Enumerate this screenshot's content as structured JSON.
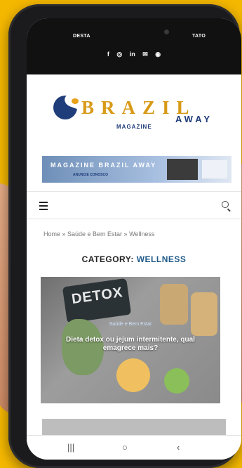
{
  "top_menu": {
    "left": "DESTA",
    "right": "TATO"
  },
  "social_icons": [
    "f",
    "◎",
    "in",
    "✉",
    "◉"
  ],
  "logo": {
    "brand": "BRAZIL",
    "sub": "MAGAZINE",
    "away": "AWAY"
  },
  "banner": {
    "title": "MAGAZINE BRAZIL AWAY",
    "cta": "ANUNCIE CONOSCO"
  },
  "breadcrumb": "Home » Saúde e Bem Estar » Wellness",
  "category": {
    "prefix": "CATEGORY:",
    "name": "WELLNESS"
  },
  "post": {
    "category_line": "Saúde e Bem Estar",
    "title": "Dieta detox ou jejum intermitente, qual emagrece mais?",
    "image_word": "DETOX"
  },
  "android_nav": {
    "recent": "|||",
    "home": "○",
    "back": "‹"
  },
  "colors": {
    "background": "#f5b800",
    "brand_gold": "#d89a18",
    "brand_blue": "#1f3d7a"
  }
}
